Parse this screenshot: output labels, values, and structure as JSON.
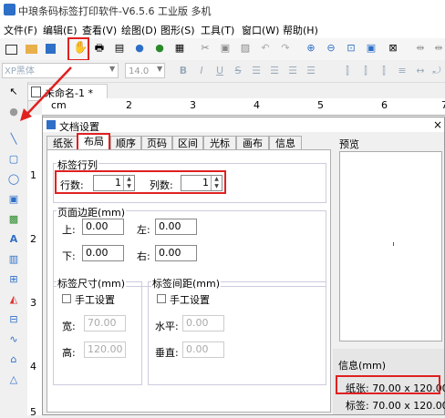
{
  "app": {
    "title": "中琅条码标签打印软件-V6.5.6 工业版 多机"
  },
  "menu": [
    "文件(F)",
    "编辑(E)",
    "查看(V)",
    "绘图(D)",
    "图形(S)",
    "工具(T)",
    "窗口(W)",
    "帮助(H)"
  ],
  "toolbar2": {
    "font": "XP黑体",
    "size": "14.0",
    "fmt": [
      "B",
      "I",
      "U",
      "S"
    ]
  },
  "document_tab": "未命名-1 *",
  "ruler": {
    "h_unit": "cm",
    "h": [
      "2",
      "3",
      "4",
      "5",
      "6",
      "7"
    ],
    "v": [
      "1",
      "2",
      "3",
      "4",
      "5"
    ]
  },
  "dialog": {
    "title": "文档设置",
    "close": "×",
    "tabs": [
      "纸张",
      "布局",
      "顺序",
      "页码",
      "区间",
      "光标",
      "画布",
      "信息"
    ],
    "label_rowcol": {
      "title": "标签行列",
      "rows_label": "行数:",
      "rows_value": "1",
      "cols_label": "列数:",
      "cols_value": "1"
    },
    "margins": {
      "title": "页面边距(mm)",
      "top_label": "上:",
      "top_value": "0.00",
      "left_label": "左:",
      "left_value": "0.00",
      "bottom_label": "下:",
      "bottom_value": "0.00",
      "right_label": "右:",
      "right_value": "0.00"
    },
    "label_size": {
      "title": "标签尺寸(mm)",
      "manual": "手工设置",
      "width_label": "宽:",
      "width_value": "70.00",
      "height_label": "高:",
      "height_value": "120.00"
    },
    "label_gap": {
      "title": "标签间距(mm)",
      "manual": "手工设置",
      "h_label": "水平:",
      "h_value": "0.00",
      "v_label": "垂直:",
      "v_value": "0.00"
    },
    "preview": {
      "label": "预览"
    },
    "info": {
      "title": "信息(mm)",
      "paper": "纸张: 70.00 x 120.00",
      "label": "标签: 70.00 x 120.00"
    }
  },
  "colors": {
    "highlight": "#e02020",
    "brand": "#2e6fc7"
  }
}
